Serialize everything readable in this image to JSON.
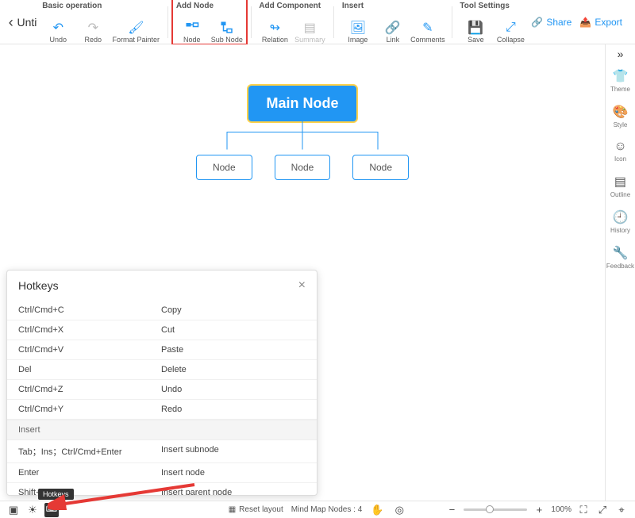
{
  "doc_title": "Untitl…",
  "toolbar": {
    "groups": {
      "basic": {
        "label": "Basic operation",
        "undo": "Undo",
        "redo": "Redo",
        "format_painter": "Format Painter"
      },
      "add_node": {
        "label": "Add Node",
        "node": "Node",
        "sub_node": "Sub Node"
      },
      "add_component": {
        "label": "Add Component",
        "relation": "Relation",
        "summary": "Summary"
      },
      "insert": {
        "label": "Insert",
        "image": "Image",
        "link": "Link",
        "comments": "Comments"
      },
      "tool_settings": {
        "label": "Tool Settings",
        "save": "Save",
        "collapse": "Collapse"
      }
    },
    "share": "Share",
    "export": "Export"
  },
  "mindmap": {
    "main": "Main Node",
    "children": [
      "Node",
      "Node",
      "Node"
    ]
  },
  "sidebar": {
    "theme": "Theme",
    "style": "Style",
    "icon": "Icon",
    "outline": "Outline",
    "history": "History",
    "feedback": "Feedback"
  },
  "hotkeys": {
    "title": "Hotkeys",
    "rows": [
      {
        "key": "Ctrl/Cmd+C",
        "action": "Copy"
      },
      {
        "key": "Ctrl/Cmd+X",
        "action": "Cut"
      },
      {
        "key": "Ctrl/Cmd+V",
        "action": "Paste"
      },
      {
        "key": "Del",
        "action": "Delete"
      },
      {
        "key": "Ctrl/Cmd+Z",
        "action": "Undo"
      },
      {
        "key": "Ctrl/Cmd+Y",
        "action": "Redo"
      }
    ],
    "section_insert": "Insert",
    "rows2": [
      {
        "key": "Tab；Ins；Ctrl/Cmd+Enter",
        "action": "Insert subnode"
      },
      {
        "key": "Enter",
        "action": "Insert node"
      },
      {
        "key": "Shift+Tab",
        "action": "Insert parent node"
      }
    ],
    "tooltip": "Hotkeys"
  },
  "bottombar": {
    "reset_layout": "Reset layout",
    "nodes_label": "Mind Map Nodes",
    "nodes_count": "4",
    "zoom_percent": "100%"
  }
}
